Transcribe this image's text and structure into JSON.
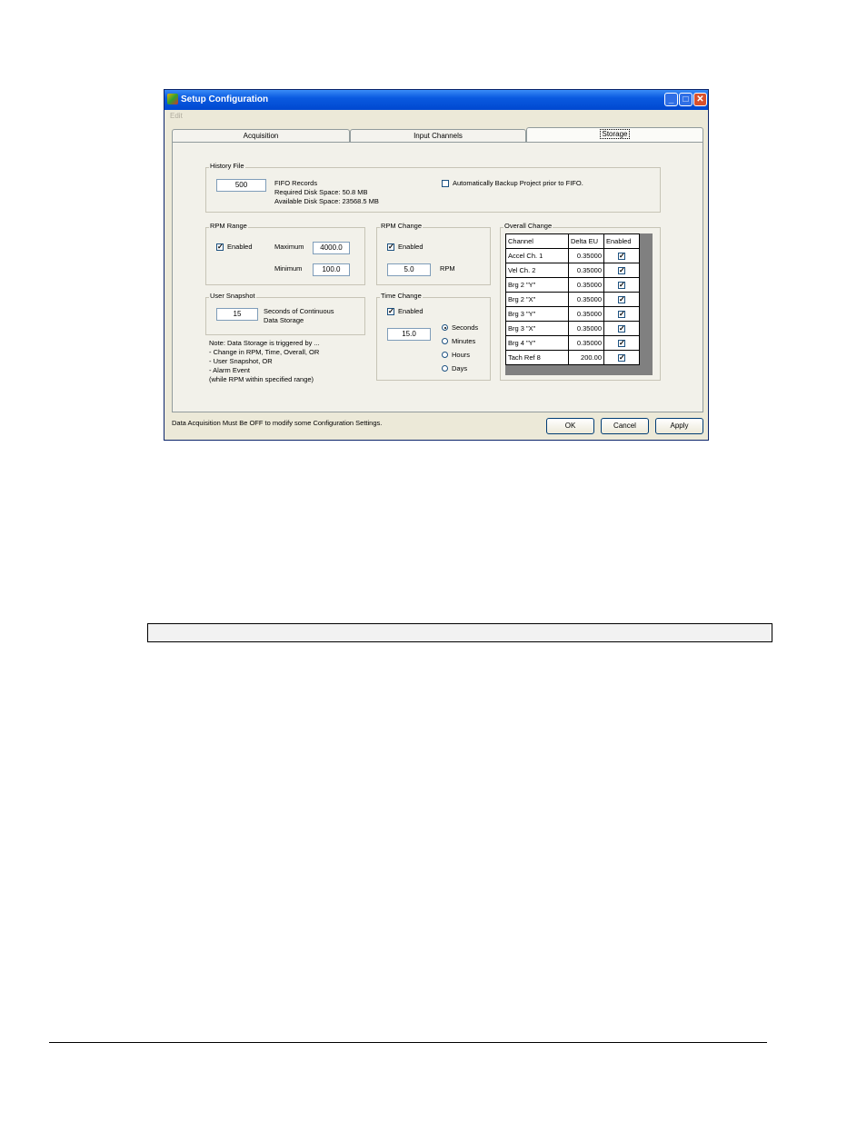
{
  "window": {
    "title": "Setup Configuration",
    "menu": [
      "Edit"
    ],
    "title_buttons": {
      "minimize": "_",
      "maximize": "□",
      "close": "✕"
    }
  },
  "tabs": [
    {
      "label": "Acquisition",
      "active": false
    },
    {
      "label": "Input Channels",
      "active": false
    },
    {
      "label": "Storage",
      "active": true
    }
  ],
  "history_file": {
    "group_label": "History File",
    "records_value": "500",
    "fifo_label": "FIFO Records",
    "required_disk": "Required Disk Space: 50.8 MB",
    "available_disk": "Available Disk Space: 23568.5 MB",
    "auto_backup_label": "Automatically Backup Project prior to FIFO.",
    "auto_backup_checked": false
  },
  "rpm_range": {
    "group_label": "RPM Range",
    "enabled_label": "Enabled",
    "enabled_checked": true,
    "maximum_label": "Maximum",
    "maximum_value": "4000.0",
    "minimum_label": "Minimum",
    "minimum_value": "100.0"
  },
  "rpm_change": {
    "group_label": "RPM Change",
    "enabled_label": "Enabled",
    "enabled_checked": true,
    "value": "5.0",
    "unit": "RPM"
  },
  "user_snapshot": {
    "group_label": "User Snapshot",
    "value": "15",
    "desc_line1": "Seconds of Continuous",
    "desc_line2": "Data Storage"
  },
  "time_change": {
    "group_label": "Time Change",
    "enabled_label": "Enabled",
    "enabled_checked": true,
    "value": "15.0",
    "units": [
      {
        "label": "Seconds",
        "selected": true
      },
      {
        "label": "Minutes",
        "selected": false
      },
      {
        "label": "Hours",
        "selected": false
      },
      {
        "label": "Days",
        "selected": false
      }
    ]
  },
  "note": [
    "Note:  Data Storage is triggered by ...",
    "- Change in RPM, Time, Overall,  OR",
    "- User Snapshot,  OR",
    "- Alarm Event",
    "(while RPM within specified range)"
  ],
  "overall_change": {
    "group_label": "Overall Change",
    "headers": [
      "Channel",
      "Delta EU",
      "Enabled"
    ],
    "rows": [
      {
        "channel": "Accel Ch. 1",
        "delta": "0.35000",
        "enabled": true
      },
      {
        "channel": "Vel Ch. 2",
        "delta": "0.35000",
        "enabled": true
      },
      {
        "channel": "Brg 2 \"Y\"",
        "delta": "0.35000",
        "enabled": true
      },
      {
        "channel": "Brg 2 \"X\"",
        "delta": "0.35000",
        "enabled": true
      },
      {
        "channel": "Brg 3 \"Y\"",
        "delta": "0.35000",
        "enabled": true
      },
      {
        "channel": "Brg 3 \"X\"",
        "delta": "0.35000",
        "enabled": true
      },
      {
        "channel": "Brg 4 \"Y\"",
        "delta": "0.35000",
        "enabled": true
      },
      {
        "channel": "Tach Ref 8",
        "delta": "200.00",
        "enabled": true
      }
    ]
  },
  "status_text": "Data Acquisition Must Be OFF to modify some Configuration Settings.",
  "buttons": {
    "ok": "OK",
    "cancel": "Cancel",
    "apply": "Apply"
  }
}
